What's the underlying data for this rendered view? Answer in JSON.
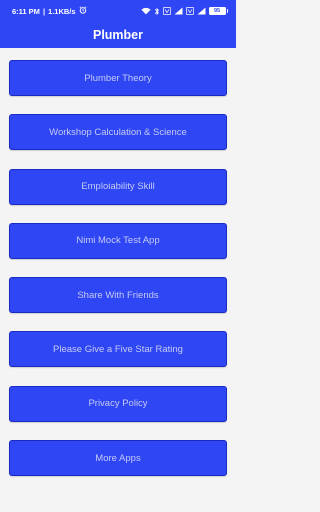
{
  "status_bar": {
    "time": "6:11 PM",
    "speed": "1.1KB/s",
    "battery": "95"
  },
  "app_bar": {
    "title": "Plumber"
  },
  "menu": {
    "items": [
      {
        "label": "Plumber Theory"
      },
      {
        "label": "Workshop Calculation & Science"
      },
      {
        "label": "Emploiability Skill"
      },
      {
        "label": "Nimi Mock Test App"
      },
      {
        "label": "Share With Friends"
      },
      {
        "label": "Please Give a Five Star Rating"
      },
      {
        "label": "Privacy Policy"
      },
      {
        "label": "More Apps"
      }
    ]
  },
  "colors": {
    "primary": "#2f46f4",
    "button_text": "#c5cbf5",
    "background": "#f4f4f4"
  }
}
